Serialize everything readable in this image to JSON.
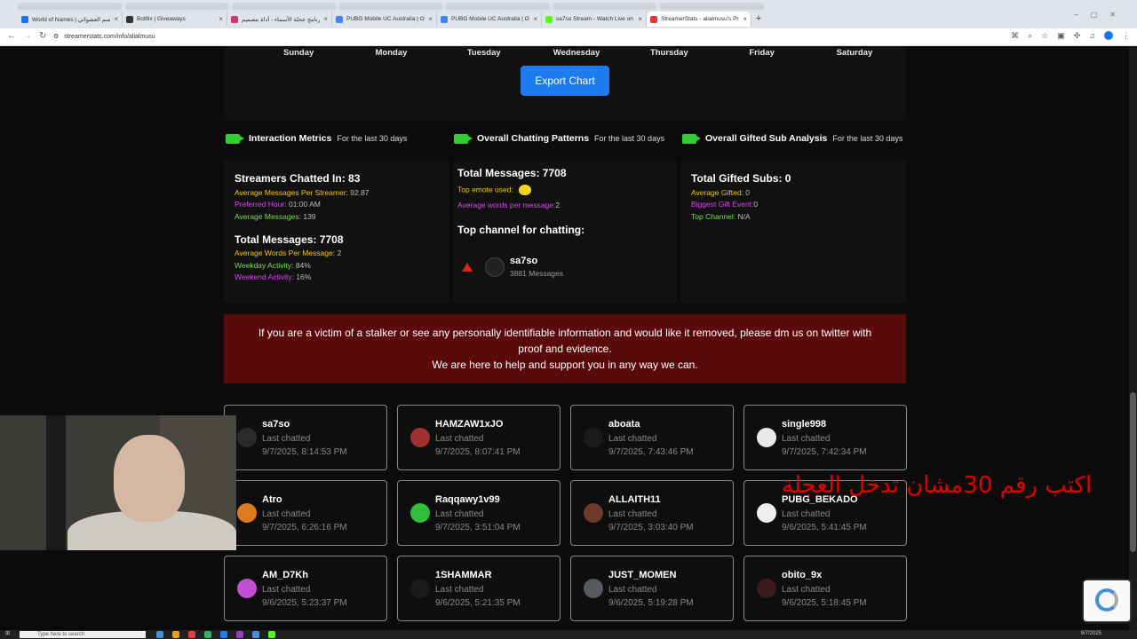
{
  "browser": {
    "tabs": [
      {
        "title": "World of Names | اسم العشوائي",
        "color": "#1a73e8"
      },
      {
        "title": "Botflix | Giveaways",
        "color": "#333333"
      },
      {
        "title": "برنامج عجلة الأسماء - أداة بتصميم",
        "color": "#d6336c"
      },
      {
        "title": "PUBG Mobile UC Australia | Off",
        "color": "#4285f4"
      },
      {
        "title": "PUBG Mobile UC Australia | Off",
        "color": "#4285f4"
      },
      {
        "title": "sa7so Stream - Watch Live on K",
        "color": "#53fc18"
      },
      {
        "title": "StreamerStats - alialmusu's Prof",
        "color": "#e53935"
      }
    ],
    "url": "streamerstats.com/info/alialmusu"
  },
  "chart": {
    "days": [
      "Sunday",
      "Monday",
      "Tuesday",
      "Wednesday",
      "Thursday",
      "Friday",
      "Saturday"
    ],
    "export_label": "Export Chart"
  },
  "sections": {
    "interaction": {
      "title": "Interaction Metrics",
      "sub": "For the last 30 days"
    },
    "chatting": {
      "title": "Overall Chatting Patterns",
      "sub": "For the last 30 days"
    },
    "gifted": {
      "title": "Overall Gifted Sub Analysis",
      "sub": "For the last 30 days"
    }
  },
  "interaction": {
    "streamers_chatted": "Streamers Chatted In: 83",
    "avg_per_streamer_label": "Average Messages Per Streamer:",
    "avg_per_streamer": "92.87",
    "preferred_hour_label": "Preferred Hour:",
    "preferred_hour": "01:00 AM",
    "avg_messages_label": "Average Messages:",
    "avg_messages": "139",
    "total_messages": "Total Messages: 7708",
    "avg_words_label": "Average Words Per Message:",
    "avg_words": "2",
    "weekday_label": "Weekday Activity:",
    "weekday": "84%",
    "weekend_label": "Weekend Activity:",
    "weekend": "16%"
  },
  "chatting": {
    "total_messages": "Total Messages: 7708",
    "top_emote_label": "Top emote used:",
    "avg_words_label": "Average words per message:",
    "avg_words": "2",
    "top_channel_title": "Top channel for chatting:",
    "top_channel_name": "sa7so",
    "top_channel_messages": "3881 Messages"
  },
  "gifted": {
    "total": "Total Gifted Subs: 0",
    "avg_label": "Average Gifted:",
    "avg": "0",
    "biggest_label": "Biggest Gift Event:",
    "biggest": "0",
    "top_channel_label": "Top Channel:",
    "top_channel": "N/A"
  },
  "banner": {
    "line1": "If you are a victim of a stalker or see any personally identifiable information and would like it removed, please dm us on twitter with",
    "line2": "proof and evidence.",
    "line3": "We are here to help and support you in any way we can."
  },
  "last_chatted_label": "Last chatted",
  "channels": [
    {
      "name": "sa7so",
      "date": "9/7/2025, 8:14:53 PM",
      "color": "#2a2a2a"
    },
    {
      "name": "HAMZAW1xJO",
      "date": "9/7/2025, 8:07:41 PM",
      "color": "#a03030"
    },
    {
      "name": "aboata",
      "date": "9/7/2025, 7:43:46 PM",
      "color": "#1a1a1a"
    },
    {
      "name": "single998",
      "date": "9/7/2025, 7:42:34 PM",
      "color": "#e8e8e8"
    },
    {
      "name": "Atro",
      "date": "9/7/2025, 6:26:16 PM",
      "color": "#e07a20"
    },
    {
      "name": "Raqqawy1v99",
      "date": "9/7/2025, 3:51:04 PM",
      "color": "#2fbf3a"
    },
    {
      "name": "ALLAITH11",
      "date": "9/7/2025, 3:03:40 PM",
      "color": "#6b3a2a"
    },
    {
      "name": "PUBG_BEKADO",
      "date": "9/6/2025, 5:41:45 PM",
      "color": "#eeeeee"
    },
    {
      "name": "AM_D7Kh",
      "date": "9/6/2025, 5:23:37 PM",
      "color": "#c050d0"
    },
    {
      "name": "1SHAMMAR",
      "date": "9/6/2025, 5:21:35 PM",
      "color": "#1a1a1a"
    },
    {
      "name": "JUST_MOMEN",
      "date": "9/6/2025, 5:19:28 PM",
      "color": "#555a60"
    },
    {
      "name": "obito_9x",
      "date": "9/6/2025, 5:18:45 PM",
      "color": "#3a1a1a"
    }
  ],
  "overlay_text": "اكتب رقم 30مشان تدخل العجلة",
  "taskbar": {
    "search_placeholder": "Type here to search",
    "date": "9/7/2025"
  }
}
